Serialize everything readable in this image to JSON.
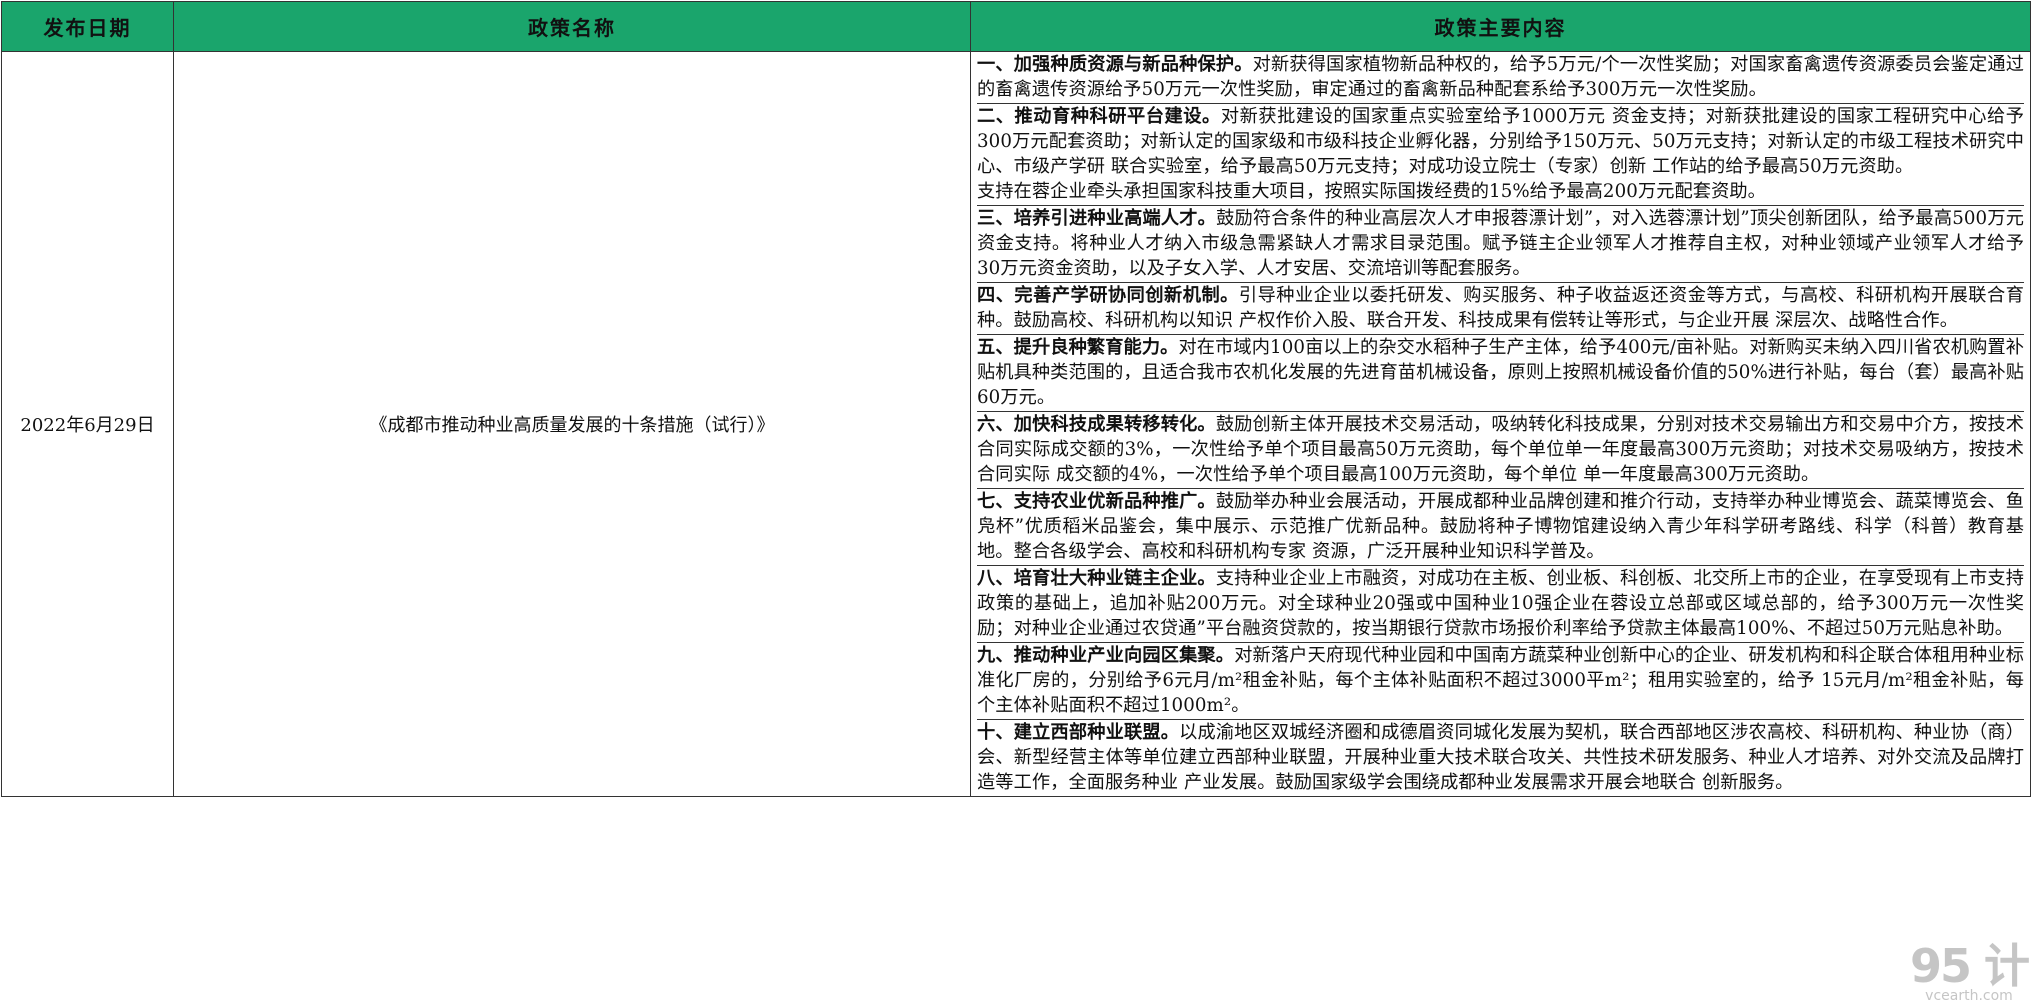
{
  "table": {
    "headers": {
      "date": "发布日期",
      "name": "政策名称",
      "content": "政策主要内容"
    },
    "row": {
      "date": "2022年6月29日",
      "name": "《成都市推动种业高质量发展的十条措施（试行）》",
      "items": [
        {
          "title": "一、加强种质资源与新品种保护。",
          "body": "对新获得国家植物新品种权的，给予5万元/个一次性奖励；对国家畜禽遗传资源委员会鉴定通过的畜禽遗传资源给予50万元一次性奖励，审定通过的畜禽新品种配套系给予300万元一次性奖励。",
          "extra": ""
        },
        {
          "title": "二、推动育种科研平台建设。",
          "body": "对新获批建设的国家重点实验室给予1000万元 资金支持；对新获批建设的国家工程研究中心给予300万元配套资助；对新认定的国家级和市级科技企业孵化器，分别给予150万元、50万元支持；对新认定的市级工程技术研究中心、市级产学研 联合实验室，给予最高50万元支持；对成功设立院士（专家）创新 工作站的给予最高50万元资助。",
          "extra": "支持在蓉企业牵头承担国家科技重大项目，按照实际国拨经费的15%给予最高200万元配套资助。"
        },
        {
          "title": "三、培养引进种业高端人才。",
          "body": "鼓励符合条件的种业高层次人才申报蓉漂计划”，对入选蓉漂计划”顶尖创新团队，给予最高500万元资金支持。将种业人才纳入市级急需紧缺人才需求目录范围。赋予链主企业领军人才推荐自主权，对种业领域产业领军人才给予30万元资金资助，以及子女入学、人才安居、交流培训等配套服务。",
          "extra": ""
        },
        {
          "title": "四、完善产学研协同创新机制。",
          "body": "引导种业企业以委托研发、购买服务、种子收益返还资金等方式，与高校、科研机构开展联合育种。鼓励高校、科研机构以知识 产权作价入股、联合开发、科技成果有偿转让等形式，与企业开展 深层次、战略性合作。",
          "extra": ""
        },
        {
          "title": "五、提升良种繁育能力。",
          "body": "对在市域内100亩以上的杂交水稻种子生产主体，给予400元/亩补贴。对新购买未纳入四川省农机购置补贴机具种类范围的，且适合我市农机化发展的先进育苗机械设备，原则上按照机械设备价值的50%进行补贴，每台（套）最高补贴60万元。",
          "extra": ""
        },
        {
          "title": "六、加快科技成果转移转化。",
          "body": "鼓励创新主体开展技术交易活动，吸纳转化科技成果，分别对技术交易输出方和交易中介方，按技术合同实际成交额的3%，一次性给予单个项目最高50万元资助，每个单位单一年度最高300万元资助；对技术交易吸纳方，按技术合同实际 成交额的4%，一次性给予单个项目最高100万元资助，每个单位 单一年度最高300万元资助。",
          "extra": ""
        },
        {
          "title": "七、支持农业优新品种推广。",
          "body": "鼓励举办种业会展活动，开展成都种业品牌创建和推介行动，支持举办种业博览会、蔬菜博览会、鱼凫杯”优质稻米品鉴会，集中展示、示范推广优新品种。鼓励将种子博物馆建设纳入青少年科学研考路线、科学（科普）教育基地。整合各级学会、高校和科研机构专家 资源，广泛开展种业知识科学普及。",
          "extra": ""
        },
        {
          "title": "八、培育壮大种业链主企业。",
          "body": "支持种业企业上市融资，对成功在主板、创业板、科创板、北交所上市的企业，在享受现有上市支持政策的基础上，追加补贴200万元。对全球种业20强或中国种业10强企业在蓉设立总部或区域总部的，给予300万元一次性奖励；对种业企业通过农贷通”平台融资贷款的，按当期银行贷款市场报价利率给予贷款主体最高100%、不超过50万元贴息补助。",
          "extra": ""
        },
        {
          "title": "九、推动种业产业向园区集聚。",
          "body": "对新落户天府现代种业园和中国南方蔬菜种业创新中心的企业、研发机构和科企联合体租用种业标准化厂房的，分别给予6元月/m²租金补贴，每个主体补贴面积不超过3000平m²；租用实验室的，给予 15元月/m²租金补贴，每个主体补贴面积不超过1000m²。",
          "extra": ""
        },
        {
          "title": "十、建立西部种业联盟。",
          "body": "以成渝地区双城经济圈和成德眉资同城化发展为契机，联合西部地区涉农高校、科研机构、种业协（商）会、新型经营主体等单位建立西部种业联盟，开展种业重大技术联合攻关、共性技术研发服务、种业人才培养、对外交流及品牌打造等工作，全面服务种业 产业发展。鼓励国家级学会围绕成都种业发展需求开展会地联合 创新服务。",
          "extra": ""
        }
      ]
    }
  },
  "watermark": {
    "logo": "95 计",
    "url": "vcearth.com"
  }
}
